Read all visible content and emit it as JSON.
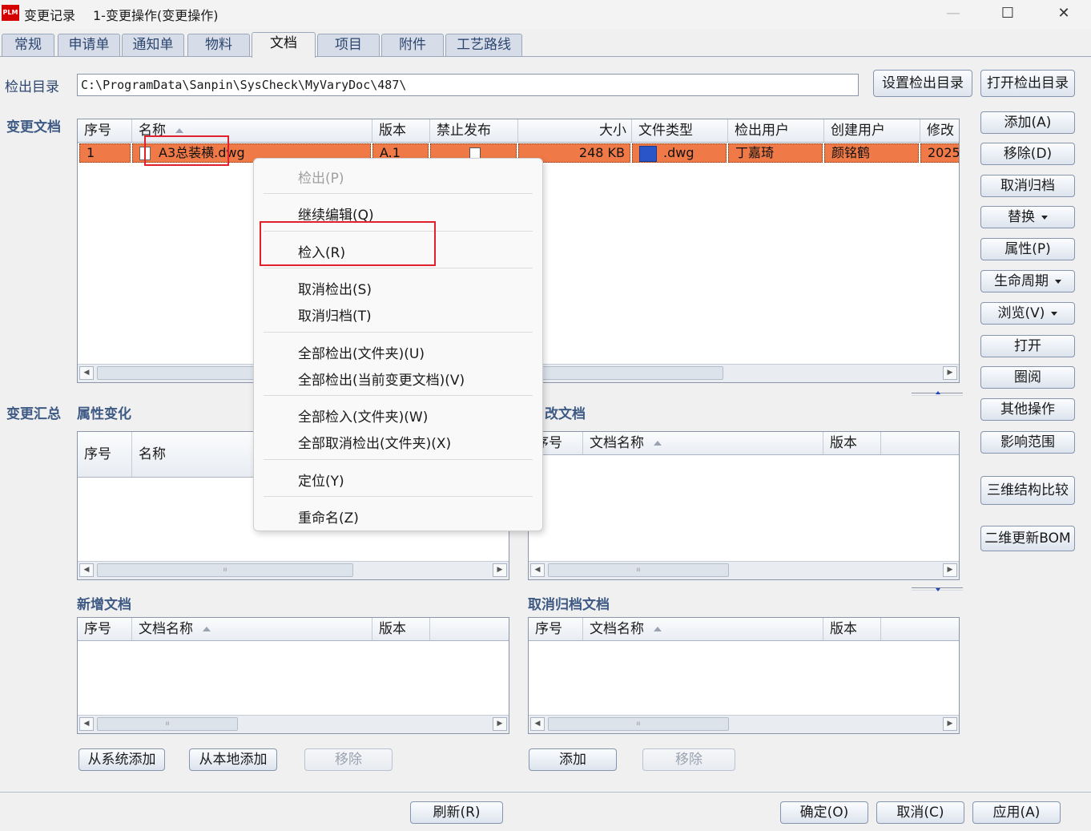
{
  "window": {
    "logo_text": "PLM",
    "title": "变更记录",
    "subtitle": "1-变更操作(变更操作)",
    "minimize": "—",
    "maximize": "☐",
    "close": "✕"
  },
  "tabs": [
    "常规",
    "申请单",
    "通知单",
    "物料",
    "文档",
    "项目",
    "附件",
    "工艺路线"
  ],
  "active_tab": "文档",
  "checkout": {
    "label": "检出目录",
    "path": "C:\\ProgramData\\Sanpin\\SysCheck\\MyVaryDoc\\487\\",
    "set_button": "设置检出目录",
    "open_button": "打开检出目录"
  },
  "change_docs": {
    "title": "变更文档",
    "columns": [
      "序号",
      "名称",
      "版本",
      "禁止发布",
      "大小",
      "文件类型",
      "检出用户",
      "创建用户",
      "修改"
    ],
    "rows": [
      {
        "seq": "1",
        "name": "A3总装横.dwg",
        "version": "A.1",
        "forbid_release": false,
        "size": "248 KB",
        "file_type": ".dwg",
        "checkout_user": "丁嘉琦",
        "create_user": "颜铭鹤",
        "modified": "2025"
      }
    ]
  },
  "side_buttons": {
    "add": "添加(A)",
    "remove": "移除(D)",
    "cancel_archive": "取消归档",
    "replace": "替换",
    "properties": "属性(P)",
    "lifecycle": "生命周期",
    "browse": "浏览(V)",
    "open": "打开",
    "circulate": "圈阅",
    "other_ops": "其他操作",
    "impact_scope": "影响范围",
    "compare_3d": "三维结构比较",
    "update_bom_2d": "二维更新BOM"
  },
  "summary": {
    "title": "变更汇总",
    "prop_changes": "属性变化",
    "columns": [
      "序号",
      "名称"
    ]
  },
  "modified_docs": {
    "title": "改文档",
    "columns": [
      "序号",
      "文档名称",
      "版本"
    ]
  },
  "new_docs": {
    "title": "新增文档",
    "columns": [
      "序号",
      "文档名称",
      "版本"
    ],
    "add_from_system": "从系统添加",
    "add_from_local": "从本地添加",
    "remove": "移除"
  },
  "cancel_archive_docs": {
    "title": "取消归档文档",
    "columns": [
      "序号",
      "文档名称",
      "版本"
    ],
    "add": "添加",
    "remove": "移除"
  },
  "context_menu": {
    "checkout": "检出(P)",
    "continue_edit": "继续编辑(Q)",
    "checkin": "检入(R)",
    "cancel_checkout": "取消检出(S)",
    "cancel_archive": "取消归档(T)",
    "checkout_all_folder": "全部检出(文件夹)(U)",
    "checkout_all_current": "全部检出(当前变更文档)(V)",
    "checkin_all_folder": "全部检入(文件夹)(W)",
    "cancel_all_checkout_folder": "全部取消检出(文件夹)(X)",
    "locate": "定位(Y)",
    "rename": "重命名(Z)"
  },
  "footer": {
    "refresh": "刷新(R)",
    "ok": "确定(O)",
    "cancel": "取消(C)",
    "apply": "应用(A)"
  }
}
